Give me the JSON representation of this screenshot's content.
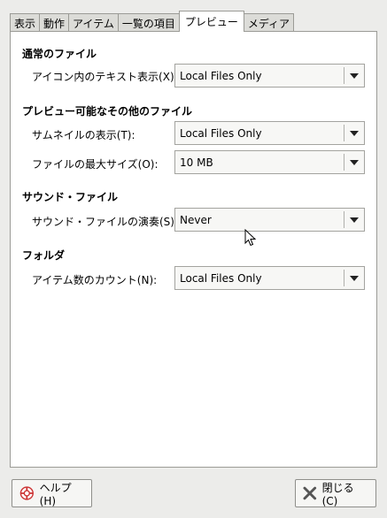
{
  "tabs": [
    {
      "label": "表示"
    },
    {
      "label": "動作"
    },
    {
      "label": "アイテム"
    },
    {
      "label": "一覧の項目"
    },
    {
      "label": "プレビュー",
      "active": true
    },
    {
      "label": "メディア"
    }
  ],
  "sections": {
    "normal_files": {
      "title": "通常のファイル",
      "rows": [
        {
          "label": "アイコン内のテキスト表示(X):",
          "value": "Local Files Only"
        }
      ]
    },
    "other_previewable": {
      "title": "プレビュー可能なその他のファイル",
      "rows": [
        {
          "label": "サムネイルの表示(T):",
          "value": "Local Files Only"
        },
        {
          "label": "ファイルの最大サイズ(O):",
          "value": "10 MB"
        }
      ]
    },
    "sound_files": {
      "title": "サウンド・ファイル",
      "rows": [
        {
          "label": "サウンド・ファイルの演奏(S):",
          "value": "Never"
        }
      ]
    },
    "folders": {
      "title": "フォルダ",
      "rows": [
        {
          "label": "アイテム数のカウント(N):",
          "value": "Local Files Only"
        }
      ]
    }
  },
  "buttons": {
    "help": {
      "label": "ヘルプ(H)",
      "icon": "lifebuoy-icon"
    },
    "close": {
      "label": "閉じる(C)",
      "icon": "close-x-icon"
    }
  },
  "colors": {
    "help_icon": "#cc3333",
    "close_icon": "#555555"
  }
}
